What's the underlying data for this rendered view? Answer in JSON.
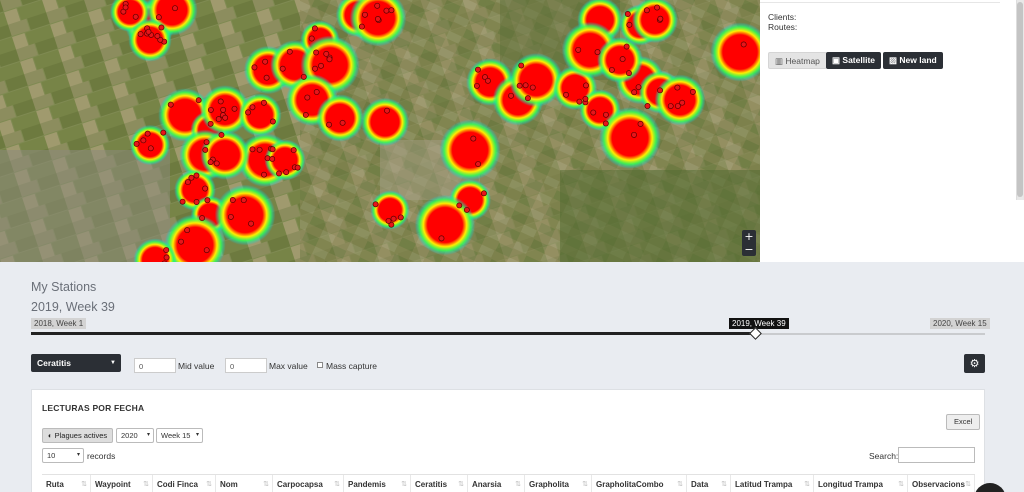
{
  "side": {
    "clients_label": "Clients:",
    "routes_label": "Routes:",
    "layers": [
      {
        "id": "heatmap",
        "icon": "map-icon",
        "label": "Heatmap",
        "active": false
      },
      {
        "id": "satellite",
        "icon": "images-icon",
        "label": "Satellite",
        "active": true
      },
      {
        "id": "newland",
        "icon": "image-icon",
        "label": "New land",
        "active": true
      }
    ]
  },
  "map_controls": {
    "zoom_in": "+",
    "zoom_out": "−"
  },
  "stations": {
    "title": "My Stations",
    "current_week": "2019, Week 39",
    "slider": {
      "start_label": "2018, Week 1",
      "current_label": "2019, Week 39",
      "end_label": "2020, Week 15",
      "position": 0.76
    }
  },
  "filters": {
    "pest_select": "Ceratitis",
    "mid_value": "0",
    "mid_label": "Mid value",
    "max_value": "0",
    "max_label": "Max value",
    "mass_capture_label": "Mass capture"
  },
  "table": {
    "title": "LECTURAS POR FECHA",
    "excel_label": "Excel",
    "plagues_label": "Plagues actives",
    "year": "2020",
    "week": "Week 15",
    "page_size": "10",
    "records_label": "records",
    "search_label": "Search:",
    "columns": [
      "Ruta",
      "Waypoint",
      "Codi Finca",
      "Nom",
      "Carpocapsa",
      "Pandemis",
      "Ceratitis",
      "Anarsia",
      "Grapholita",
      "GrapholitaCombo",
      "Data",
      "Latitud Trampa",
      "Longitud Trampa",
      "Observacions"
    ]
  },
  "colors": {
    "accent_dark": "#2b2f35",
    "heat_red": "#ff0000",
    "heat_green": "#33ff55",
    "panel_bg": "#e9ecf1"
  }
}
